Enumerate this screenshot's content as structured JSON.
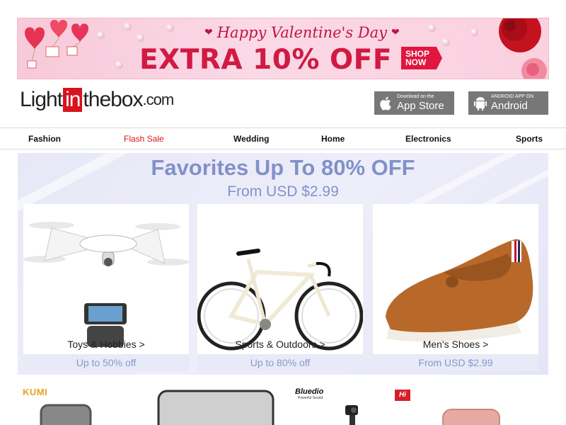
{
  "promo": {
    "heading": "Happy Valentine's Day",
    "main": "EXTRA 10% OFF",
    "cta_line1": "SHOP",
    "cta_line2": "NOW",
    "heart": "❤"
  },
  "logo": {
    "part1": "Light",
    "part2": "in",
    "part3": "thebox",
    "part4": ".com"
  },
  "apps": {
    "appstore_small": "Download on the",
    "appstore_big": "App Store",
    "android_small": "ANDROID APP ON",
    "android_big": "Android"
  },
  "nav": {
    "items": [
      "Fashion",
      "Flash Sale",
      "Wedding",
      "Home",
      "Electronics",
      "Sports"
    ]
  },
  "favorites": {
    "title": "Favorites Up To 80% OFF",
    "subtitle": "From USD $2.99",
    "cards": [
      {
        "label": "Toys & Hobbies >",
        "price": "Up to 50% off"
      },
      {
        "label": "Sports & Outdoors >",
        "price": "Up to 80% off"
      },
      {
        "label": "Men's Shoes >",
        "price": "From USD $2.99"
      }
    ]
  },
  "brands": {
    "kumi": "KUMI",
    "bluedio": "Bluedio",
    "bluedio_tagline": "Powerful Sound",
    "hi": "Hi"
  },
  "colors": {
    "accent_red": "#d6141d",
    "flash_sale": "#e0141e",
    "favorites_text": "#8191c8",
    "promo_red": "#d11a43"
  }
}
